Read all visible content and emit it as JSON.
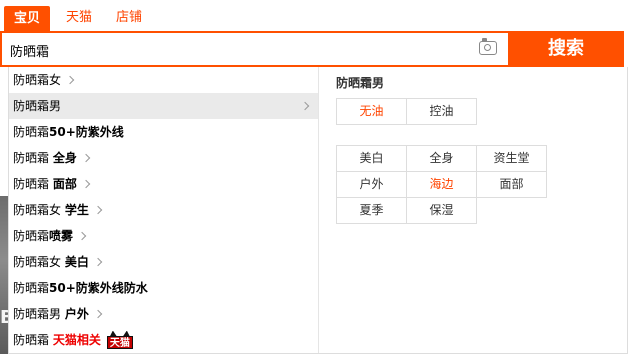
{
  "tabs": [
    {
      "label": "宝贝",
      "active": true
    },
    {
      "label": "天猫",
      "active": false
    },
    {
      "label": "店铺",
      "active": false
    }
  ],
  "search": {
    "value": "防晒霜",
    "button_label": "搜索"
  },
  "suggestions": [
    {
      "prefix": "防晒霜女",
      "suffix": "",
      "chevron": true
    },
    {
      "prefix": "防晒霜男",
      "suffix": "",
      "chevron": true,
      "hover": true
    },
    {
      "prefix": "防晒霜",
      "suffix": "50+防紫外线",
      "chevron": false
    },
    {
      "prefix": "防晒霜 ",
      "suffix": "全身",
      "chevron": true
    },
    {
      "prefix": "防晒霜 ",
      "suffix": "面部",
      "chevron": true
    },
    {
      "prefix": "防晒霜女 ",
      "suffix": "学生",
      "chevron": true
    },
    {
      "prefix": "防晒霜",
      "suffix": "喷雾",
      "chevron": true
    },
    {
      "prefix": "防晒霜女 ",
      "suffix": "美白",
      "chevron": true
    },
    {
      "prefix": "防晒霜",
      "suffix": "50+防紫外线防水",
      "chevron": false
    },
    {
      "prefix": "防晒霜男 ",
      "suffix": "户外",
      "chevron": true
    },
    {
      "prefix": "防晒霜 ",
      "tmall_text": "天猫相关",
      "badge_text": "天猫"
    }
  ],
  "right_panel": {
    "title": "防晒霜男",
    "group1": [
      {
        "label": "无油",
        "highlight": true
      },
      {
        "label": "控油",
        "highlight": false
      }
    ],
    "group2": [
      {
        "label": "美白",
        "highlight": false
      },
      {
        "label": "全身",
        "highlight": false
      },
      {
        "label": "资生堂",
        "highlight": false
      },
      {
        "label": "户外",
        "highlight": false
      },
      {
        "label": "海边",
        "highlight": true
      },
      {
        "label": "面部",
        "highlight": false
      },
      {
        "label": "夏季",
        "highlight": false
      },
      {
        "label": "保湿",
        "highlight": false
      }
    ]
  },
  "background": {
    "edge_glyph": "B"
  },
  "colors": {
    "accent": "#ff5000",
    "highlight_text": "#ff4400",
    "hover_row": "#eaeaea",
    "tmall_red": "#c40000"
  }
}
